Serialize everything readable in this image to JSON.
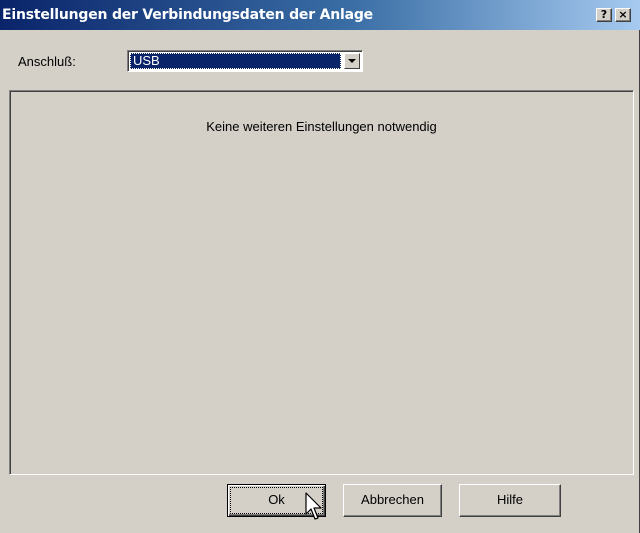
{
  "window": {
    "title": "Einstellungen der Verbindungsdaten der Anlage",
    "help_glyph": "?",
    "close_glyph": "×"
  },
  "connection": {
    "label": "Anschluß:",
    "selected_value": "USB"
  },
  "panel": {
    "message": "Keine weiteren Einstellungen notwendig"
  },
  "buttons": {
    "ok": "Ok",
    "cancel": "Abbrechen",
    "help": "Hilfe"
  },
  "icons": {
    "dropdown": "chevron-down-icon",
    "cursor": "mouse-pointer-icon"
  },
  "colors": {
    "face": "#d4d0c8",
    "title_start": "#0a246a",
    "title_end": "#a6caf0",
    "selection": "#0a246a"
  }
}
